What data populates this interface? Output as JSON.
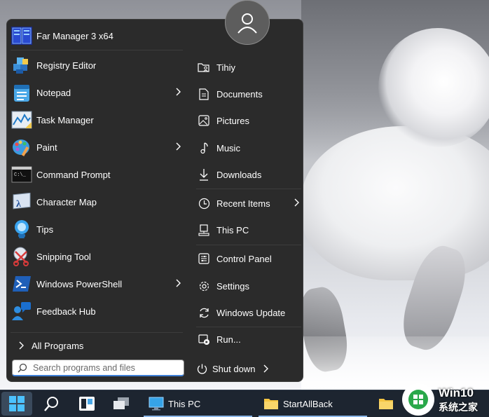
{
  "start_menu": {
    "pinned_apps": [
      {
        "label": "Far Manager 3 x64",
        "icon": "far-manager-icon",
        "has_submenu": false
      },
      {
        "label": "Registry Editor",
        "icon": "registry-editor-icon",
        "has_submenu": false
      },
      {
        "label": "Notepad",
        "icon": "notepad-icon",
        "has_submenu": true
      },
      {
        "label": "Task Manager",
        "icon": "task-manager-icon",
        "has_submenu": false
      },
      {
        "label": "Paint",
        "icon": "paint-icon",
        "has_submenu": true
      },
      {
        "label": "Command Prompt",
        "icon": "command-prompt-icon",
        "has_submenu": false
      },
      {
        "label": "Character Map",
        "icon": "character-map-icon",
        "has_submenu": false
      },
      {
        "label": "Tips",
        "icon": "tips-icon",
        "has_submenu": false
      },
      {
        "label": "Snipping Tool",
        "icon": "snipping-tool-icon",
        "has_submenu": false
      },
      {
        "label": "Windows PowerShell",
        "icon": "powershell-icon",
        "has_submenu": true
      },
      {
        "label": "Feedback Hub",
        "icon": "feedback-hub-icon",
        "has_submenu": false
      }
    ],
    "all_programs_label": "All Programs",
    "search_placeholder": "Search programs and files",
    "places": [
      {
        "label": "Tihiy",
        "icon": "user-folder-icon",
        "has_submenu": false
      },
      {
        "label": "Documents",
        "icon": "document-icon",
        "has_submenu": false
      },
      {
        "label": "Pictures",
        "icon": "picture-icon",
        "has_submenu": false
      },
      {
        "label": "Music",
        "icon": "music-icon",
        "has_submenu": false
      },
      {
        "label": "Downloads",
        "icon": "download-icon",
        "has_submenu": false
      },
      {
        "label": "Recent Items",
        "icon": "clock-icon",
        "has_submenu": true
      },
      {
        "label": "This PC",
        "icon": "computer-icon",
        "has_submenu": false
      },
      {
        "label": "Control Panel",
        "icon": "control-panel-icon",
        "has_submenu": false
      },
      {
        "label": "Settings",
        "icon": "gear-icon",
        "has_submenu": false
      },
      {
        "label": "Windows Update",
        "icon": "refresh-icon",
        "has_submenu": false
      },
      {
        "label": "Run...",
        "icon": "run-icon",
        "has_submenu": false
      }
    ],
    "shutdown_label": "Shut down"
  },
  "taskbar": {
    "tasks": [
      {
        "label": "This PC",
        "icon": "monitor-icon"
      },
      {
        "label": "StartAllBack",
        "icon": "folder-icon"
      }
    ]
  },
  "watermark": {
    "line1": "Win10",
    "line2": "系统之家"
  },
  "colors": {
    "menu_bg": "#2b2b2b",
    "taskbar_bg": "#1d2530",
    "accent": "#3e7fd6"
  }
}
